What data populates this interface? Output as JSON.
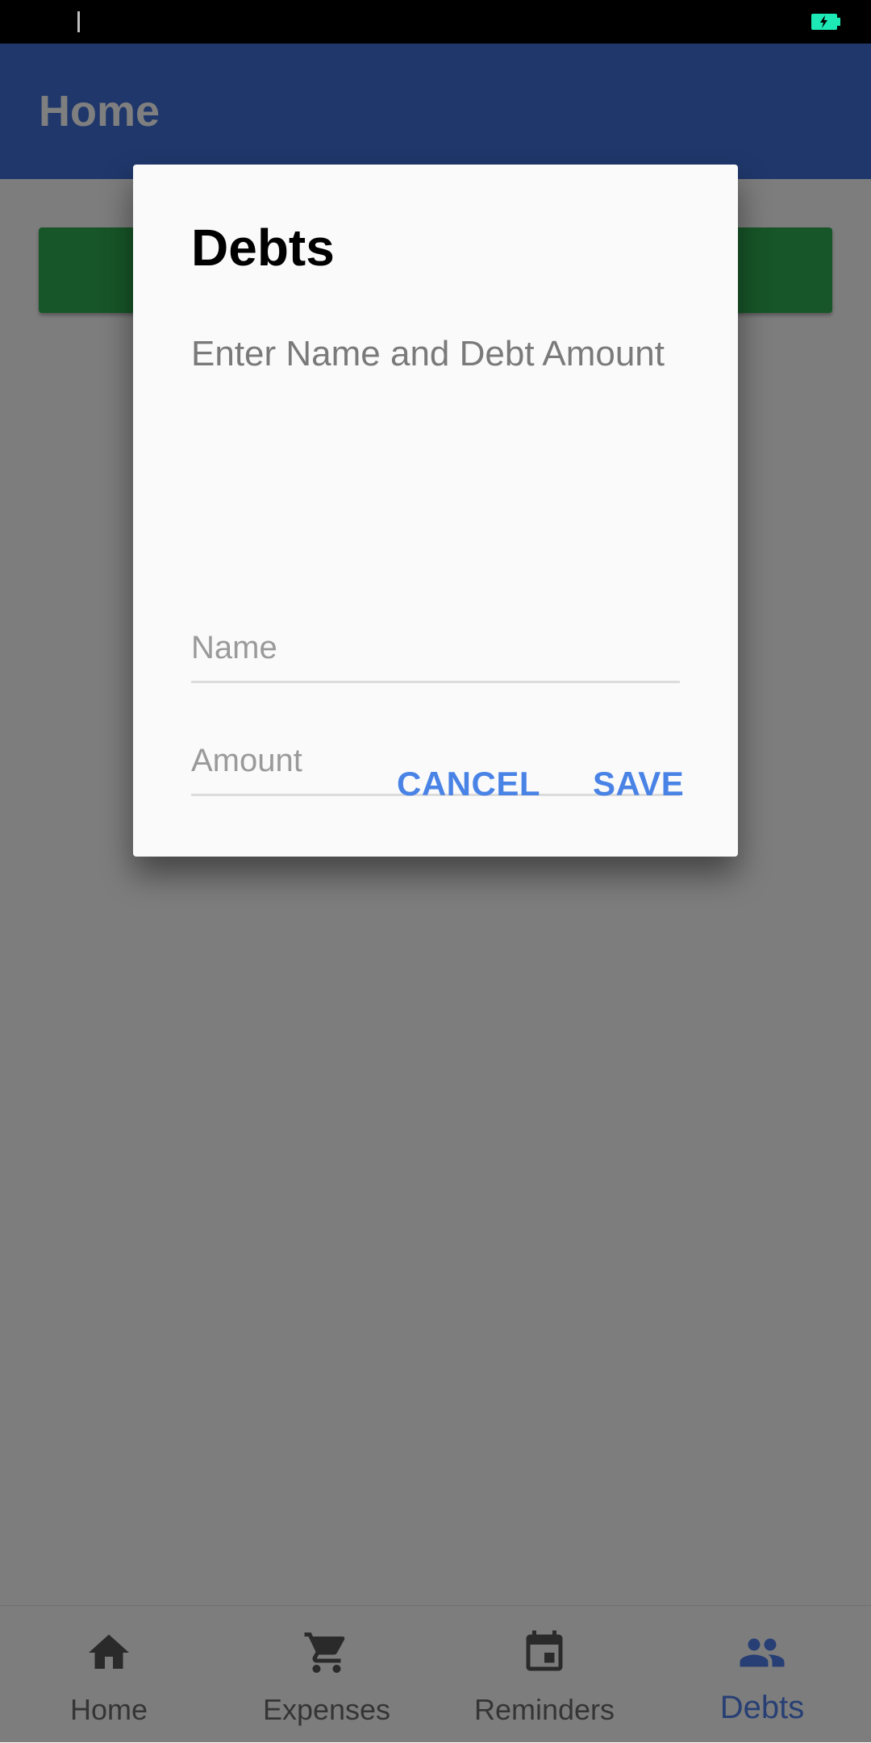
{
  "app_bar": {
    "title": "Home"
  },
  "dialog": {
    "title": "Debts",
    "subtitle": "Enter Name and Debt Amount",
    "name_field": {
      "placeholder": "Name",
      "value": ""
    },
    "amount_field": {
      "placeholder": "Amount",
      "value": ""
    },
    "cancel_label": "CANCEL",
    "save_label": "SAVE"
  },
  "bottom_nav": {
    "items": [
      {
        "label": "Home",
        "icon": "home-icon",
        "active": false
      },
      {
        "label": "Expenses",
        "icon": "cart-icon",
        "active": false
      },
      {
        "label": "Reminders",
        "icon": "calendar-icon",
        "active": false
      },
      {
        "label": "Debts",
        "icon": "people-icon",
        "active": true
      }
    ]
  },
  "colors": {
    "app_bar": "#3f6fd6",
    "accent": "#4a83e6",
    "primary_button": "#2ead50",
    "battery": "#1de9b6"
  }
}
